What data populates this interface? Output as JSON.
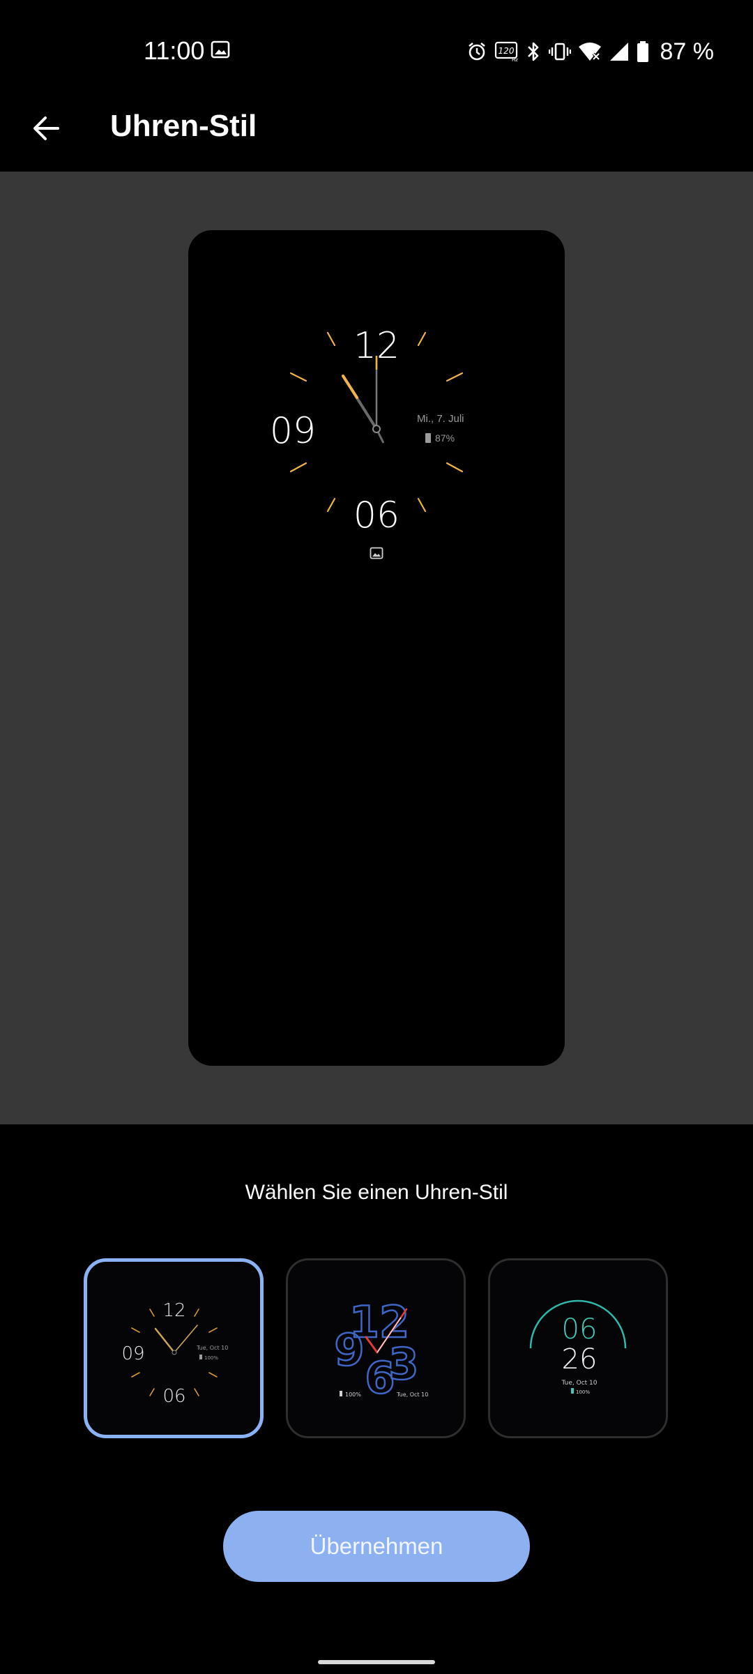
{
  "status_bar": {
    "time": "11:00",
    "battery_text": "87 %",
    "icons": [
      "image-icon",
      "alarm-icon",
      "refresh-rate-120hz-icon",
      "bluetooth-icon",
      "vibrate-icon",
      "wifi-icon",
      "cellular-signal-icon",
      "battery-icon"
    ]
  },
  "app_bar": {
    "back_icon": "arrow-back-icon",
    "title": "Uhren-Stil"
  },
  "preview": {
    "clock_numerals": [
      "12",
      "09",
      "06"
    ],
    "date": "Mi., 7. Juli",
    "battery": "87%",
    "notification_icon": "image-icon",
    "accent_color": "#f0b24a"
  },
  "chooser": {
    "label": "Wählen Sie einen Uhren-Stil",
    "styles": [
      {
        "name": "analog-dial",
        "numerals": [
          "12",
          "09",
          "06"
        ],
        "date": "Tue, Oct 10",
        "battery": "100%",
        "selected": true
      },
      {
        "name": "big-numbers",
        "numerals": [
          "12",
          "9",
          "6",
          "3"
        ],
        "date": "Tue, Oct 10",
        "battery": "100%",
        "selected": false
      },
      {
        "name": "digital-arc",
        "hours": "06",
        "minutes": "26",
        "date": "Tue, Oct 10",
        "battery": "100%",
        "selected": false
      }
    ],
    "selected_border_color": "#8bb2f5"
  },
  "apply_button": {
    "label": "Übernehmen",
    "color": "#8db0f1"
  }
}
